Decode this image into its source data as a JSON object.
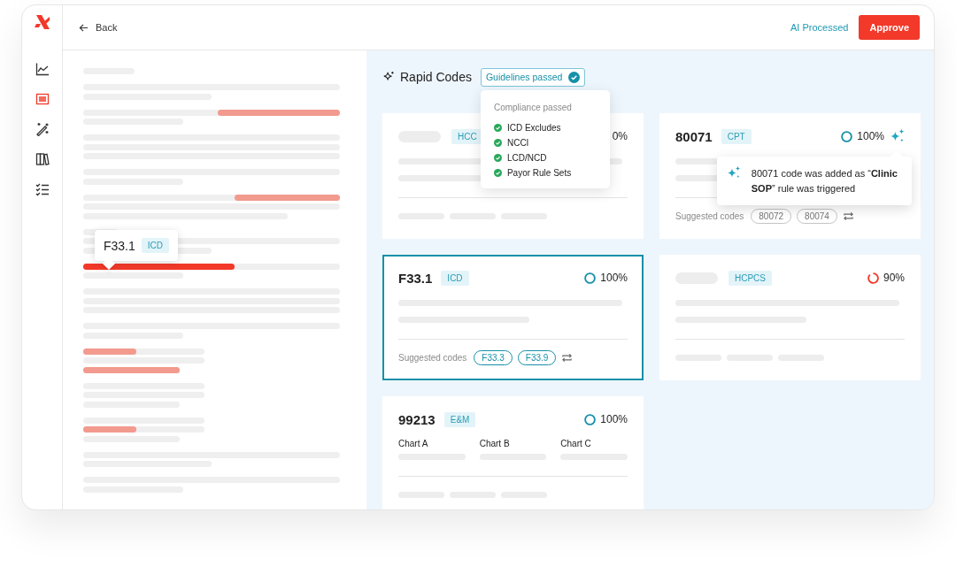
{
  "header": {
    "back": "Back",
    "status": "AI Processed",
    "approve": "Approve"
  },
  "sidebar": {
    "items": [
      {
        "kind": "chart",
        "selected": false
      },
      {
        "kind": "document",
        "selected": true
      },
      {
        "kind": "wand",
        "selected": false
      },
      {
        "kind": "books",
        "selected": false
      },
      {
        "kind": "checklist",
        "selected": false
      }
    ]
  },
  "document": {
    "tooltip": {
      "code": "F33.1",
      "tag": "ICD"
    }
  },
  "panel": {
    "title": "Rapid Codes",
    "badge": "Guidelines passed",
    "compliance": {
      "title": "Compliance passed",
      "items": [
        {
          "label": "ICD Excludes",
          "passed": true
        },
        {
          "label": "NCCI",
          "passed": true
        },
        {
          "label": "LCD/NCD",
          "passed": true
        },
        {
          "label": "Payor Rule Sets",
          "passed": true
        }
      ]
    }
  },
  "cards": [
    {
      "tag": "HCC",
      "confidence": "0%",
      "selected": false
    },
    {
      "code": "80071",
      "tag": "CPT",
      "complete": true,
      "confidence": "100%",
      "ai_added": true,
      "selected": false,
      "suggested_label": "Suggested codes",
      "suggestions": [
        "80072",
        "80074"
      ],
      "note": "80071 code was added as “**Clinic SOP**” rule was triggered"
    },
    {
      "code": "F33.1",
      "tag": "ICD",
      "complete": true,
      "confidence": "100%",
      "selected": true,
      "suggested_label": "Suggested codes",
      "suggestions": [
        "F33.3",
        "F33.9"
      ]
    },
    {
      "tag": "HCPCS",
      "complete": false,
      "confidence": "90%",
      "selected": false
    },
    {
      "code": "99213",
      "tag": "E&M",
      "complete": true,
      "confidence": "100%",
      "selected": false,
      "charts": [
        "Chart A",
        "Chart B",
        "Chart C"
      ]
    }
  ]
}
